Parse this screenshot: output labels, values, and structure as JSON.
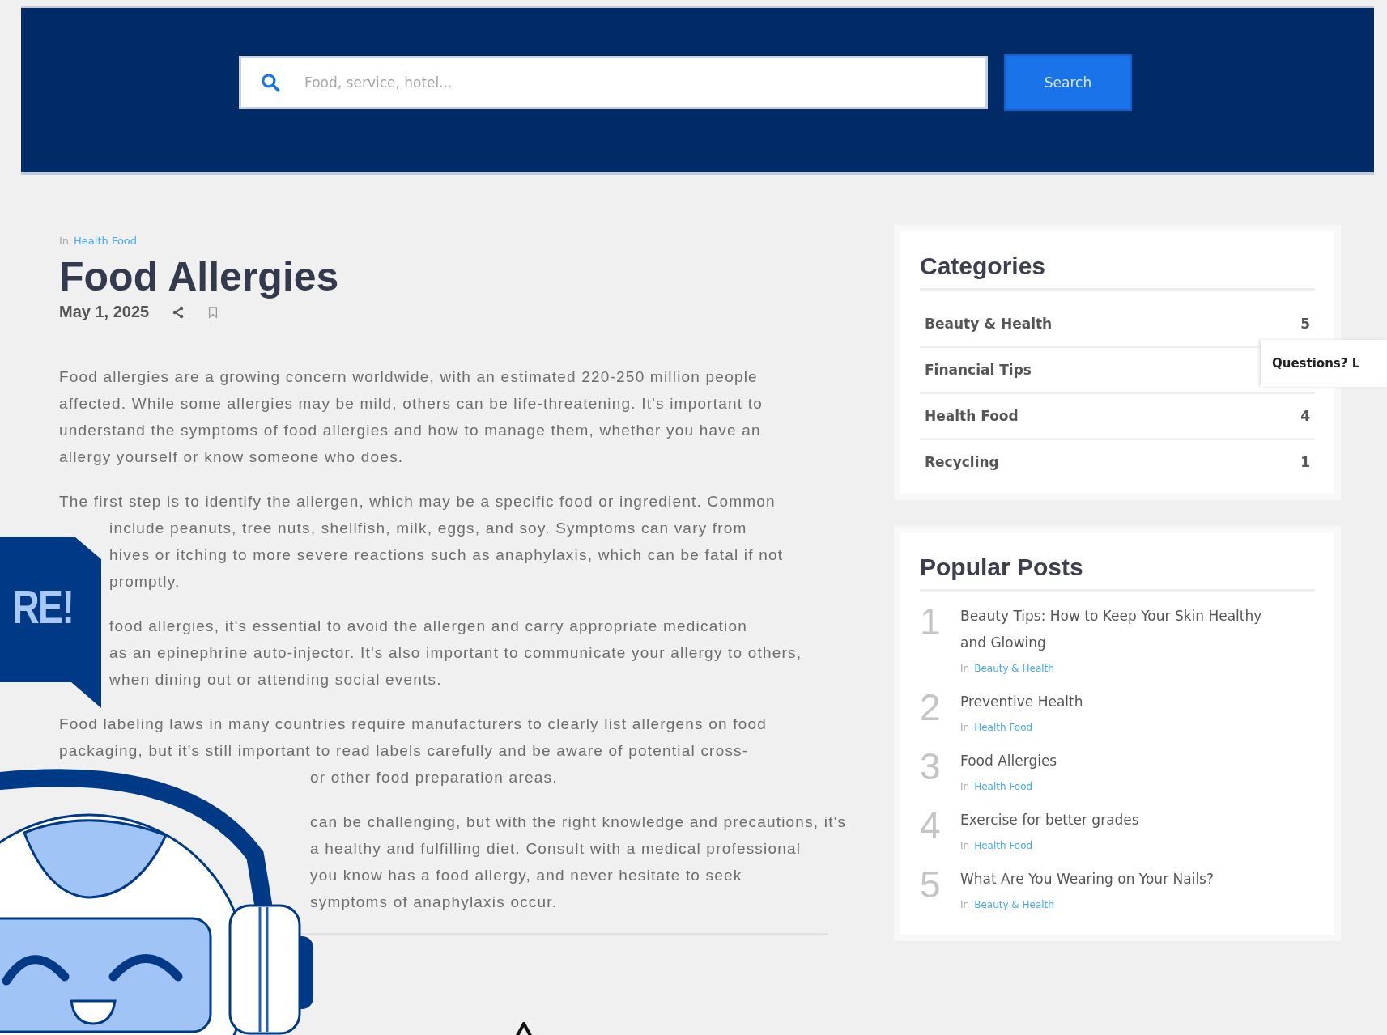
{
  "header": {
    "search": {
      "placeholder": "Food, service, hotel..."
    },
    "search_button": "Search"
  },
  "article": {
    "category_prefix": "In",
    "category": "Health Food",
    "title": "Food Allergies",
    "date": "May 1, 2025",
    "paragraphs": [
      {
        "lines": [
          {
            "kind": "full",
            "text": "Food allergies are a growing concern worldwide, with an estimated 220-250 million people"
          },
          {
            "kind": "full",
            "text": "affected. While some allergies may be mild, others can be life-threatening. It's important to"
          },
          {
            "kind": "full",
            "text": "understand the symptoms of food allergies and how to manage them, whether you have an"
          },
          {
            "kind": "full",
            "text": "allergy yourself or know someone who does."
          }
        ]
      },
      {
        "lines": [
          {
            "kind": "full",
            "text": "The first step is to identify the allergen, which may be a specific food or ingredient. Common"
          },
          {
            "kind": "bubble",
            "text": "include peanuts, tree nuts, shellfish, milk, eggs, and soy. Symptoms can vary from"
          },
          {
            "kind": "bubble",
            "text": "hives or itching to more severe reactions such as anaphylaxis, which can be fatal if not"
          },
          {
            "kind": "bubble",
            "text": "promptly."
          }
        ]
      },
      {
        "lines": [
          {
            "kind": "bubble",
            "text": "food allergies, it's essential to avoid the allergen and carry appropriate medication"
          },
          {
            "kind": "bubble",
            "text": "as an epinephrine auto-injector. It's also important to communicate your allergy to others,"
          },
          {
            "kind": "bubble",
            "text": "when dining out or attending social events."
          }
        ]
      },
      {
        "lines": [
          {
            "kind": "full",
            "text": "Food labeling laws in many countries require manufacturers to clearly list allergens on food"
          },
          {
            "kind": "full",
            "text": "packaging, but it's still important to read labels carefully and be aware of potential cross-"
          },
          {
            "kind": "robot",
            "text": "or other food preparation areas."
          }
        ]
      },
      {
        "lines": [
          {
            "kind": "robot",
            "text": "can be challenging, but with the right knowledge and precautions, it's"
          },
          {
            "kind": "robot",
            "text": "a healthy and fulfilling diet. Consult with a medical professional"
          },
          {
            "kind": "robot",
            "text": "you know has a food allergy, and never hesitate to seek"
          },
          {
            "kind": "robot",
            "text": "symptoms of anaphylaxis occur."
          }
        ]
      }
    ]
  },
  "sidebar": {
    "categories": {
      "title": "Categories",
      "items": [
        {
          "name": "Beauty & Health",
          "count": "5"
        },
        {
          "name": "Financial Tips"
        },
        {
          "name": "Health Food",
          "count": "4"
        },
        {
          "name": "Recycling",
          "count": "1"
        }
      ]
    },
    "popular_posts": {
      "title": "Popular Posts",
      "items": [
        {
          "rank": "1",
          "title": "Beauty Tips: How to Keep Your Skin Healthy and Glowing",
          "prefix": "In",
          "category": "Beauty & Health"
        },
        {
          "rank": "2",
          "title": "Preventive Health",
          "prefix": "In",
          "category": "Health Food"
        },
        {
          "rank": "3",
          "title": "Food Allergies",
          "prefix": "In",
          "category": "Health Food"
        },
        {
          "rank": "4",
          "title": "Exercise for better grades",
          "prefix": "In",
          "category": "Health Food"
        },
        {
          "rank": "5",
          "title": "What Are You Wearing on Your Nails?",
          "prefix": "In",
          "category": "Beauty & Health"
        }
      ]
    }
  },
  "chat_widget": {
    "bubble_text": "RE!",
    "tooltip": "Questions? L"
  }
}
